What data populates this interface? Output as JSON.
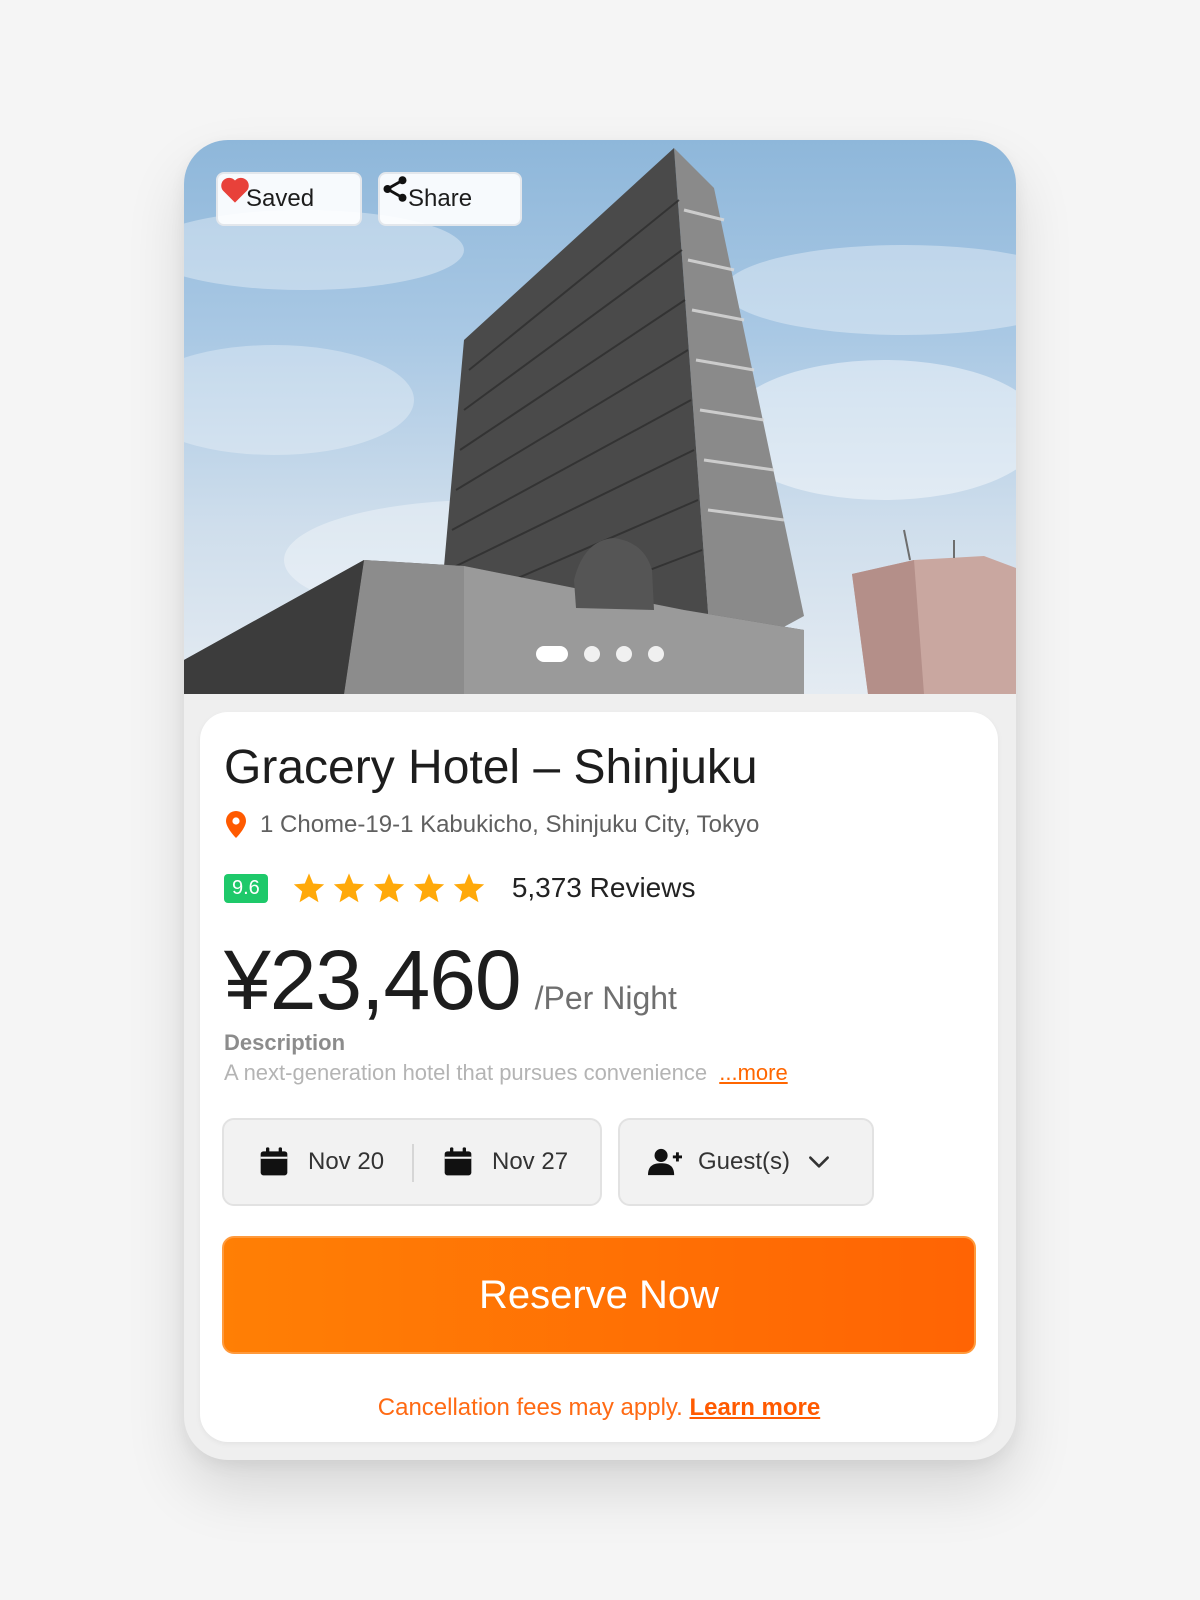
{
  "hero": {
    "saved_label": "Saved",
    "share_label": "Share",
    "carousel_count": 4,
    "carousel_active": 1
  },
  "hotel": {
    "name": "Gracery Hotel – Shinjuku",
    "address": "1 Chome-19-1 Kabukicho, Shinjuku City, Tokyo",
    "score": "9.6",
    "stars": 5,
    "reviews": "5,373 Reviews",
    "price": "¥23,460",
    "price_unit": "/Per Night",
    "description_label": "Description",
    "description": "A next-generation hotel that pursues convenience",
    "more_label": "...more"
  },
  "booking": {
    "check_in": "Nov 20",
    "check_out": "Nov 27",
    "guests_label": "Guest(s)"
  },
  "actions": {
    "reserve_label": "Reserve Now",
    "cancellation_text": "Cancellation fees may apply.",
    "learn_more_label": "Learn more"
  },
  "colors": {
    "accent": "#ff6a00",
    "score_badge": "#1ec96a",
    "star": "#ffa90a",
    "heart": "#e8413a",
    "pin": "#ff5a00"
  },
  "icons": {
    "saved": "heart-icon",
    "share": "share-icon",
    "address": "location-pin-icon",
    "date": "calendar-icon",
    "guests": "add-person-icon",
    "dropdown": "chevron-down-icon",
    "rating": "star-icon"
  }
}
